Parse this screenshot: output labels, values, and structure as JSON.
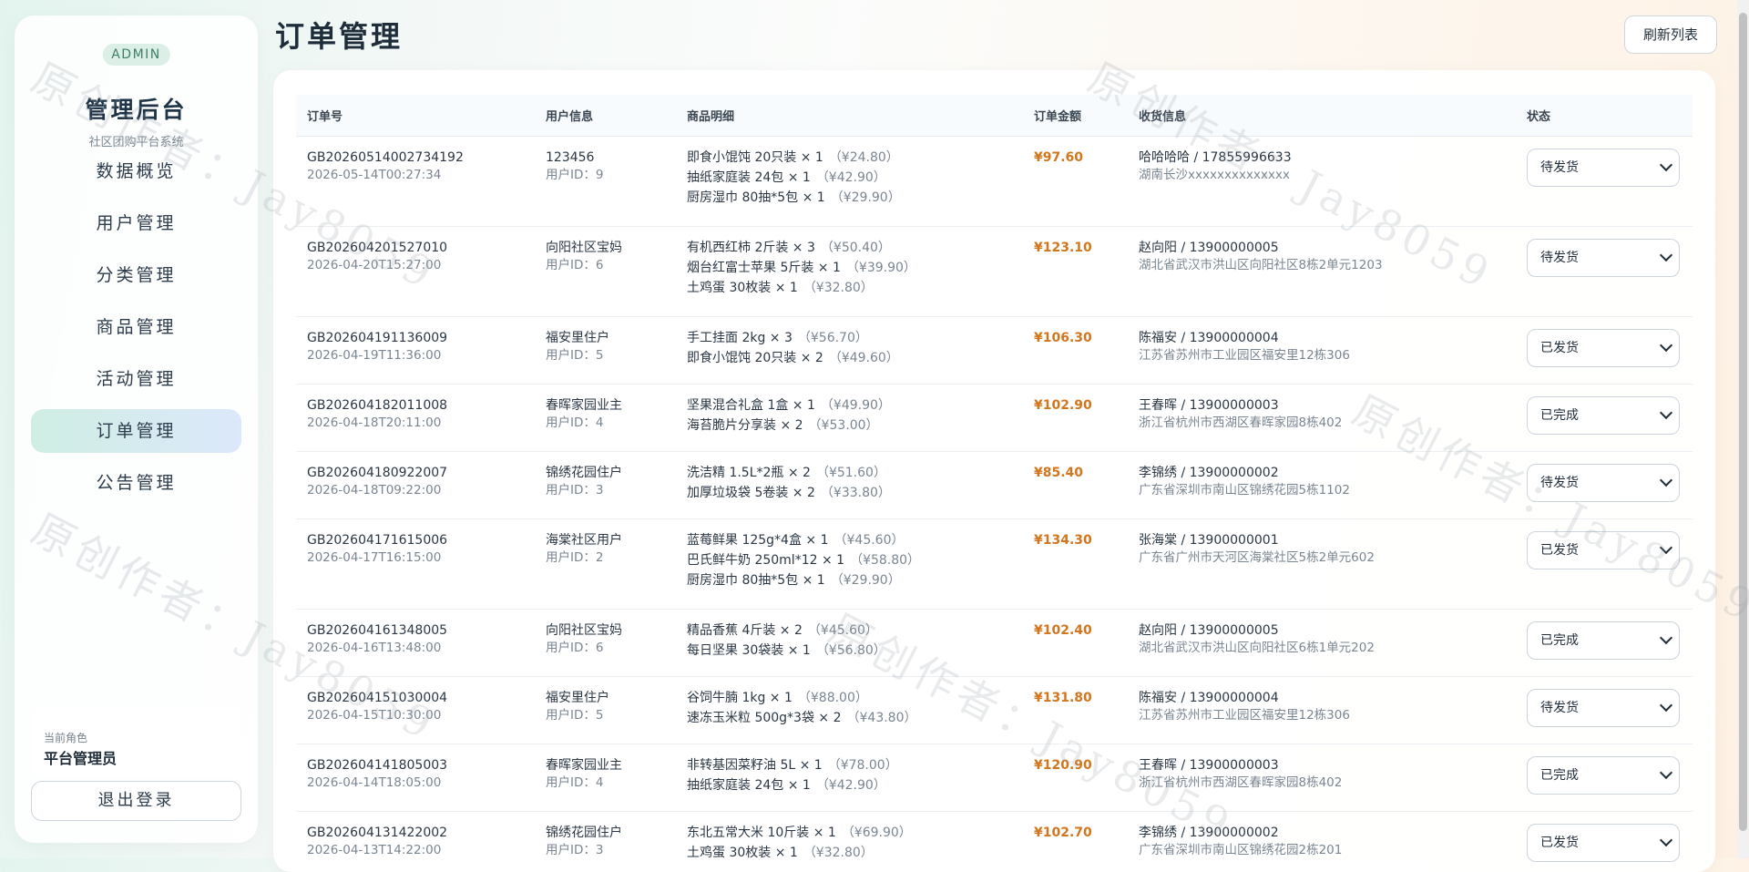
{
  "sidebar": {
    "badge": "ADMIN",
    "title": "管理后台",
    "subtitle": "社区团购平台系统",
    "items": [
      {
        "label": "数据概览",
        "active": false
      },
      {
        "label": "用户管理",
        "active": false
      },
      {
        "label": "分类管理",
        "active": false
      },
      {
        "label": "商品管理",
        "active": false
      },
      {
        "label": "活动管理",
        "active": false
      },
      {
        "label": "订单管理",
        "active": true
      },
      {
        "label": "公告管理",
        "active": false
      }
    ],
    "role_label": "当前角色",
    "role_value": "平台管理员",
    "logout_label": "退出登录"
  },
  "header": {
    "title": "订单管理",
    "refresh_label": "刷新列表"
  },
  "watermark": "原创作者：Jay8059",
  "table": {
    "columns": [
      "订单号",
      "用户信息",
      "商品明细",
      "订单金额",
      "收货信息",
      "状态"
    ],
    "status_options": [
      "待发货",
      "已发货",
      "已完成"
    ],
    "rows": [
      {
        "order_no": "GB20260514002734192",
        "time": "2026-05-14T00:27:34",
        "user": "123456",
        "user_id": "用户ID：9",
        "goods": [
          {
            "name": "即食小馄饨 20只装 × 1",
            "price": "（¥24.80）"
          },
          {
            "name": "抽纸家庭装 24包 × 1",
            "price": "（¥42.90）"
          },
          {
            "name": "厨房湿巾 80抽*5包 × 1",
            "price": "（¥29.90）"
          }
        ],
        "amount": "¥97.60",
        "receiver": "哈哈哈哈 / 17855996633",
        "address": "湖南长沙xxxxxxxxxxxxxx",
        "status": "待发货"
      },
      {
        "order_no": "GB202604201527010",
        "time": "2026-04-20T15:27:00",
        "user": "向阳社区宝妈",
        "user_id": "用户ID：6",
        "goods": [
          {
            "name": "有机西红柿 2斤装 × 3",
            "price": "（¥50.40）"
          },
          {
            "name": "烟台红富士苹果 5斤装 × 1",
            "price": "（¥39.90）"
          },
          {
            "name": "土鸡蛋 30枚装 × 1",
            "price": "（¥32.80）"
          }
        ],
        "amount": "¥123.10",
        "receiver": "赵向阳 / 13900000005",
        "address": "湖北省武汉市洪山区向阳社区8栋2单元1203",
        "status": "待发货"
      },
      {
        "order_no": "GB202604191136009",
        "time": "2026-04-19T11:36:00",
        "user": "福安里住户",
        "user_id": "用户ID：5",
        "goods": [
          {
            "name": "手工挂面 2kg × 3",
            "price": "（¥56.70）"
          },
          {
            "name": "即食小馄饨 20只装 × 2",
            "price": "（¥49.60）"
          }
        ],
        "amount": "¥106.30",
        "receiver": "陈福安 / 13900000004",
        "address": "江苏省苏州市工业园区福安里12栋306",
        "status": "已发货"
      },
      {
        "order_no": "GB202604182011008",
        "time": "2026-04-18T20:11:00",
        "user": "春晖家园业主",
        "user_id": "用户ID：4",
        "goods": [
          {
            "name": "坚果混合礼盒 1盒 × 1",
            "price": "（¥49.90）"
          },
          {
            "name": "海苔脆片分享装 × 2",
            "price": "（¥53.00）"
          }
        ],
        "amount": "¥102.90",
        "receiver": "王春晖 / 13900000003",
        "address": "浙江省杭州市西湖区春晖家园8栋402",
        "status": "已完成"
      },
      {
        "order_no": "GB202604180922007",
        "time": "2026-04-18T09:22:00",
        "user": "锦绣花园住户",
        "user_id": "用户ID：3",
        "goods": [
          {
            "name": "洗洁精 1.5L*2瓶 × 2",
            "price": "（¥51.60）"
          },
          {
            "name": "加厚垃圾袋 5卷装 × 2",
            "price": "（¥33.80）"
          }
        ],
        "amount": "¥85.40",
        "receiver": "李锦绣 / 13900000002",
        "address": "广东省深圳市南山区锦绣花园5栋1102",
        "status": "待发货"
      },
      {
        "order_no": "GB202604171615006",
        "time": "2026-04-17T16:15:00",
        "user": "海棠社区用户",
        "user_id": "用户ID：2",
        "goods": [
          {
            "name": "蓝莓鲜果 125g*4盒 × 1",
            "price": "（¥45.60）"
          },
          {
            "name": "巴氏鲜牛奶 250ml*12 × 1",
            "price": "（¥58.80）"
          },
          {
            "name": "厨房湿巾 80抽*5包 × 1",
            "price": "（¥29.90）"
          }
        ],
        "amount": "¥134.30",
        "receiver": "张海棠 / 13900000001",
        "address": "广东省广州市天河区海棠社区5栋2单元602",
        "status": "已发货"
      },
      {
        "order_no": "GB202604161348005",
        "time": "2026-04-16T13:48:00",
        "user": "向阳社区宝妈",
        "user_id": "用户ID：6",
        "goods": [
          {
            "name": "精品香蕉 4斤装 × 2",
            "price": "（¥45.60）"
          },
          {
            "name": "每日坚果 30袋装 × 1",
            "price": "（¥56.80）"
          }
        ],
        "amount": "¥102.40",
        "receiver": "赵向阳 / 13900000005",
        "address": "湖北省武汉市洪山区向阳社区6栋1单元202",
        "status": "已完成"
      },
      {
        "order_no": "GB202604151030004",
        "time": "2026-04-15T10:30:00",
        "user": "福安里住户",
        "user_id": "用户ID：5",
        "goods": [
          {
            "name": "谷饲牛腩 1kg × 1",
            "price": "（¥88.00）"
          },
          {
            "name": "速冻玉米粒 500g*3袋 × 2",
            "price": "（¥43.80）"
          }
        ],
        "amount": "¥131.80",
        "receiver": "陈福安 / 13900000004",
        "address": "江苏省苏州市工业园区福安里12栋306",
        "status": "待发货"
      },
      {
        "order_no": "GB202604141805003",
        "time": "2026-04-14T18:05:00",
        "user": "春晖家园业主",
        "user_id": "用户ID：4",
        "goods": [
          {
            "name": "非转基因菜籽油 5L × 1",
            "price": "（¥78.00）"
          },
          {
            "name": "抽纸家庭装 24包 × 1",
            "price": "（¥42.90）"
          }
        ],
        "amount": "¥120.90",
        "receiver": "王春晖 / 13900000003",
        "address": "浙江省杭州市西湖区春晖家园8栋402",
        "status": "已完成"
      },
      {
        "order_no": "GB202604131422002",
        "time": "2026-04-13T14:22:00",
        "user": "锦绣花园住户",
        "user_id": "用户ID：3",
        "goods": [
          {
            "name": "东北五常大米 10斤装 × 1",
            "price": "（¥69.90）"
          },
          {
            "name": "土鸡蛋 30枚装 × 1",
            "price": "（¥32.80）"
          }
        ],
        "amount": "¥102.70",
        "receiver": "李锦绣 / 13900000002",
        "address": "广东省深圳市南山区锦绣花园2栋201",
        "status": "已发货"
      }
    ]
  }
}
